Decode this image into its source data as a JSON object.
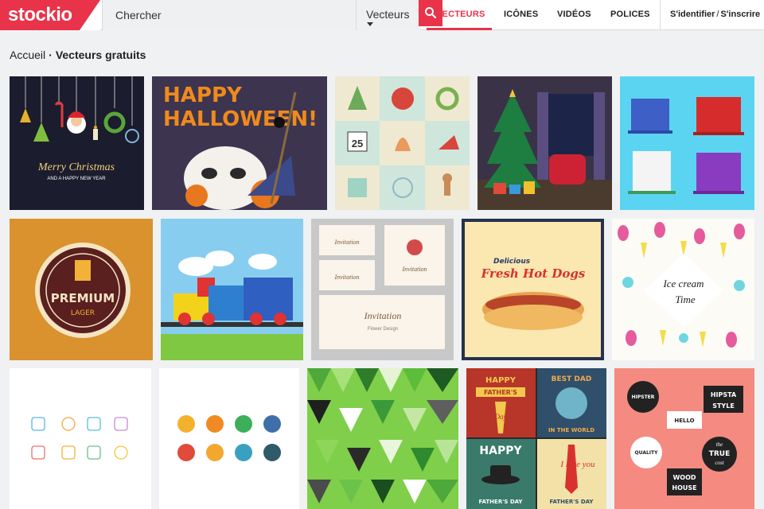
{
  "brand": {
    "name": "stockio",
    "accent": "#e8334a"
  },
  "search": {
    "placeholder": "Chercher",
    "type_selected": "Vecteurs"
  },
  "nav": {
    "items": [
      "VECTEURS",
      "ICÔNES",
      "VIDÉOS",
      "POLICES"
    ],
    "active": "VECTEURS"
  },
  "auth": {
    "login": "S'identifier",
    "separator": "/",
    "signup": "S'inscrire"
  },
  "breadcrumb": {
    "home": "Accueil",
    "separator": "·",
    "current": "Vecteurs gratuits"
  },
  "tiles": {
    "christmas": {
      "line1": "Merry Christmas",
      "line2": "AND A HAPPY NEW YEAR"
    },
    "halloween": {
      "line1": "HAPPY",
      "line2": "HALLOWEEN!"
    },
    "icons_calendar": "25",
    "premium": {
      "line1": "PREMIUM",
      "line2": "LAGER"
    },
    "invitation": {
      "card": "Invitation",
      "subtitle": "Flower Design"
    },
    "hotdog": {
      "line1": "Delicious",
      "line2": "Fresh Hot Dogs"
    },
    "icecream": {
      "line1": "Ice cream",
      "line2": "Time"
    },
    "fathers": {
      "happy_fathers": "HAPPY",
      "fathers_day": "FATHER'S",
      "day": "Day",
      "best_dad": "BEST DAD",
      "in_world": "IN THE WORLD",
      "happy": "HAPPY",
      "fathers_day_2": "FATHER'S DAY",
      "i_love_you": "I love you",
      "fathers_day_3": "FATHER'S DAY"
    },
    "hipster": {
      "hipster": "HIPSTER",
      "hipsta": "HIPSTA",
      "style": "STYLE",
      "hello": "HELLO",
      "quality": "QUALITY",
      "true": "TRUE",
      "the": "the",
      "cost": "cost",
      "wood": "WOOD",
      "house": "HOUSE"
    }
  }
}
